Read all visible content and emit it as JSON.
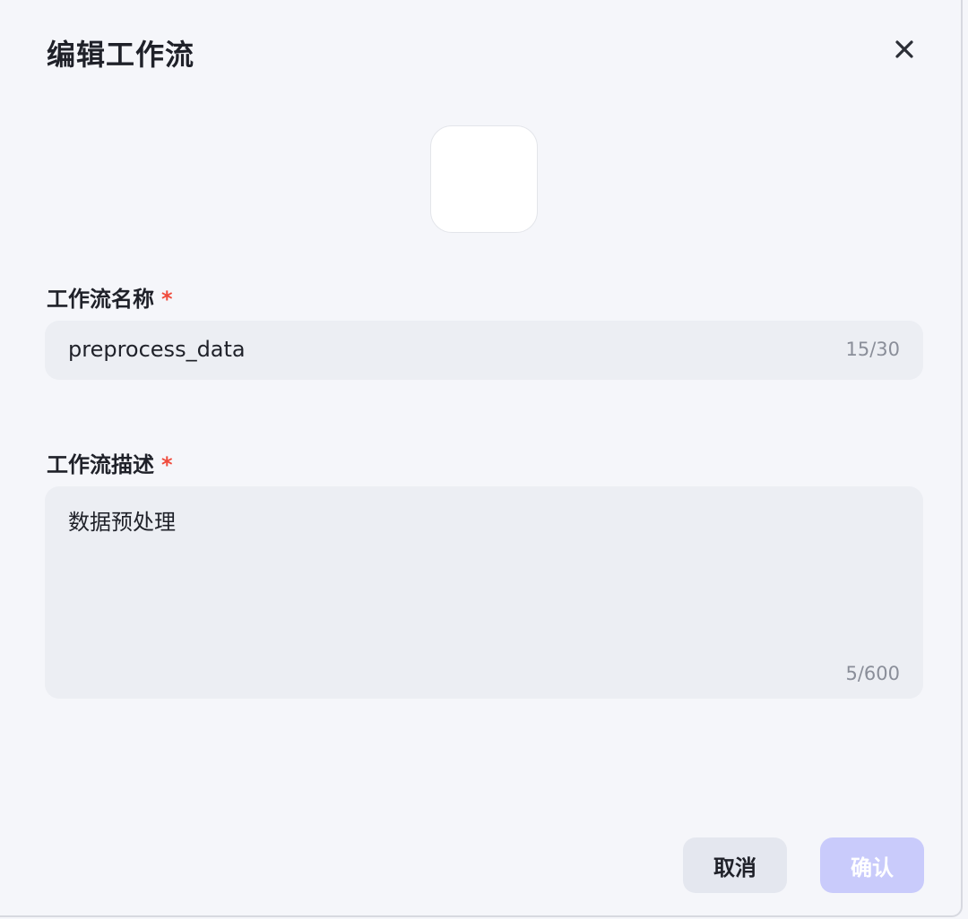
{
  "dialog": {
    "title": "编辑工作流",
    "close_icon": "close-icon"
  },
  "icon_picker": {
    "icon": "blank-icon-tile"
  },
  "name_field": {
    "label": "工作流名称",
    "required_mark": "*",
    "value": "preprocess_data",
    "counter": "15/30"
  },
  "description_field": {
    "label": "工作流描述",
    "required_mark": "*",
    "value": "数据预处理",
    "counter": "5/600"
  },
  "footer": {
    "cancel_label": "取消",
    "confirm_label": "确认"
  },
  "colors": {
    "required": "#f04b3c",
    "confirm_disabled_bg": "#c9cbfb",
    "field_bg": "#eceef3"
  }
}
